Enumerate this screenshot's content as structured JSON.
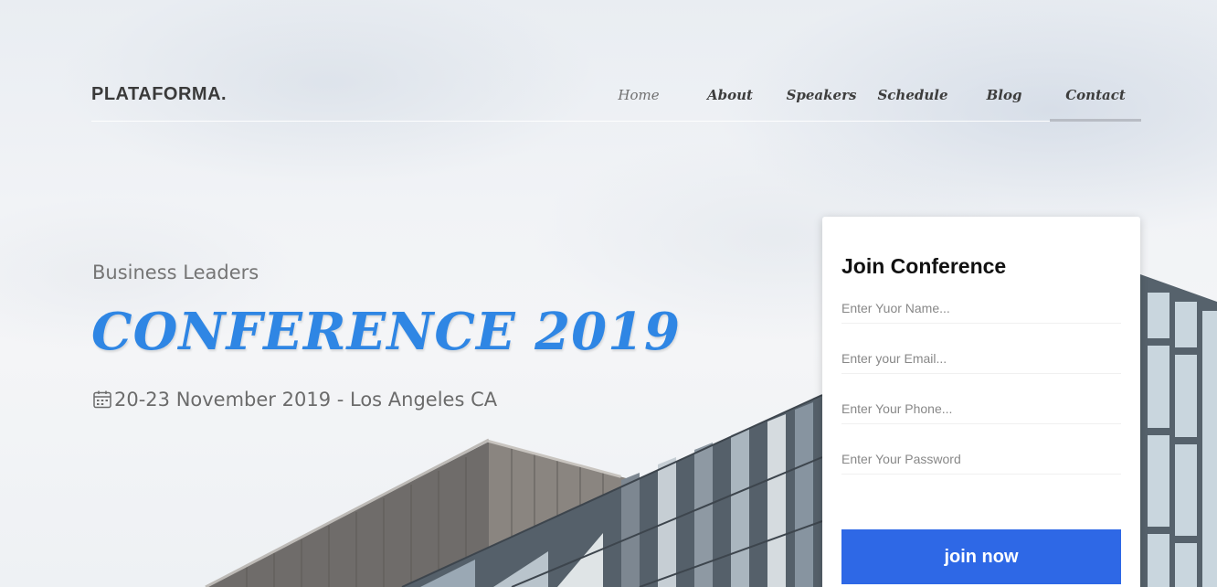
{
  "header": {
    "logo": "PLATAFORMA.",
    "nav": [
      {
        "label": "Home"
      },
      {
        "label": "About"
      },
      {
        "label": "Speakers"
      },
      {
        "label": "Schedule"
      },
      {
        "label": "Blog"
      },
      {
        "label": "Contact",
        "active": true
      }
    ]
  },
  "hero": {
    "subtitle": "Business Leaders",
    "headline": "CONFERENCE 2019",
    "date_icon": "calendar-icon",
    "date": "20-23 November 2019 - Los Angeles CA"
  },
  "form": {
    "title": "Join Conference",
    "name_placeholder": "Enter Yuor Name...",
    "email_placeholder": "Enter your Email...",
    "phone_placeholder": "Enter Your Phone...",
    "password_placeholder": "Enter Your Password",
    "submit_label": "join now"
  },
  "colors": {
    "headline": "#2f86e4",
    "button": "#2e68e6"
  }
}
